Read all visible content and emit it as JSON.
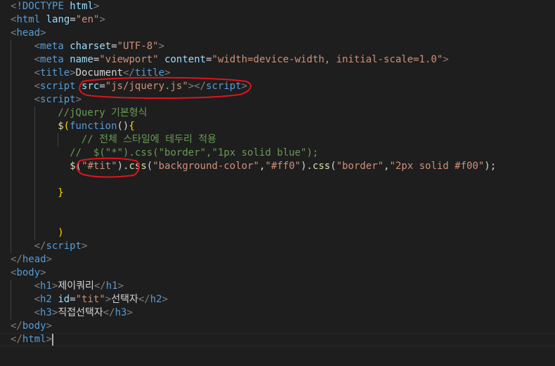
{
  "lines": [
    {
      "indent": 0,
      "tokens": [
        [
          "t-bracket",
          "<"
        ],
        [
          "t-tag",
          "!DOCTYPE "
        ],
        [
          "t-attr",
          "html"
        ],
        [
          "t-bracket",
          ">"
        ]
      ]
    },
    {
      "indent": 0,
      "tokens": [
        [
          "t-bracket",
          "<"
        ],
        [
          "t-tag",
          "html "
        ],
        [
          "t-attr",
          "lang"
        ],
        [
          "t-plain",
          "="
        ],
        [
          "t-str",
          "\"en\""
        ],
        [
          "t-bracket",
          ">"
        ]
      ]
    },
    {
      "indent": 0,
      "tokens": [
        [
          "t-bracket",
          "<"
        ],
        [
          "t-tag",
          "head"
        ],
        [
          "t-bracket",
          ">"
        ]
      ]
    },
    {
      "indent": 1,
      "tokens": [
        [
          "t-bracket",
          "<"
        ],
        [
          "t-tag",
          "meta "
        ],
        [
          "t-attr",
          "charset"
        ],
        [
          "t-plain",
          "="
        ],
        [
          "t-str",
          "\"UTF-8\""
        ],
        [
          "t-bracket",
          ">"
        ]
      ]
    },
    {
      "indent": 1,
      "tokens": [
        [
          "t-bracket",
          "<"
        ],
        [
          "t-tag",
          "meta "
        ],
        [
          "t-attr",
          "name"
        ],
        [
          "t-plain",
          "="
        ],
        [
          "t-str",
          "\"viewport\""
        ],
        [
          "t-plain",
          " "
        ],
        [
          "t-attr",
          "content"
        ],
        [
          "t-plain",
          "="
        ],
        [
          "t-str",
          "\"width=device-width, initial-scale=1.0\""
        ],
        [
          "t-bracket",
          ">"
        ]
      ]
    },
    {
      "indent": 1,
      "tokens": [
        [
          "t-bracket",
          "<"
        ],
        [
          "t-tag",
          "title"
        ],
        [
          "t-bracket",
          ">"
        ],
        [
          "t-text",
          "Document"
        ],
        [
          "t-bracket",
          "</"
        ],
        [
          "t-tag",
          "title"
        ],
        [
          "t-bracket",
          ">"
        ]
      ]
    },
    {
      "indent": 1,
      "tokens": [
        [
          "t-bracket",
          "<"
        ],
        [
          "t-tag",
          "script "
        ],
        [
          "t-attr",
          "src"
        ],
        [
          "t-plain",
          "="
        ],
        [
          "t-str",
          "\"js/jquery.js\""
        ],
        [
          "t-bracket",
          "></"
        ],
        [
          "t-tag",
          "script"
        ],
        [
          "t-bracket",
          ">"
        ]
      ]
    },
    {
      "indent": 1,
      "tokens": [
        [
          "t-bracket",
          "<"
        ],
        [
          "t-tag",
          "script"
        ],
        [
          "t-bracket",
          ">"
        ]
      ]
    },
    {
      "indent": 2,
      "tokens": [
        [
          "t-comment",
          "//jQuery 기본형식"
        ]
      ]
    },
    {
      "indent": 2,
      "tokens": [
        [
          "t-func",
          "$"
        ],
        [
          "t-brace",
          "("
        ],
        [
          "t-kw",
          "function"
        ],
        [
          "t-plain",
          "()"
        ],
        [
          "t-brace",
          "{"
        ]
      ]
    },
    {
      "indent": 3,
      "tokens": [
        [
          "t-comment",
          "// 전체 스타일에 테두리 적용"
        ]
      ]
    },
    {
      "indent": 2,
      "extra": "  ",
      "tokens": [
        [
          "t-comment",
          "//  $(\"*\").css(\"border\",\"1px solid blue\");"
        ]
      ]
    },
    {
      "indent": 2,
      "extra": "  ",
      "tokens": [
        [
          "t-func",
          "$"
        ],
        [
          "t-plain",
          "("
        ],
        [
          "t-str",
          "\"#tit\""
        ],
        [
          "t-plain",
          ")."
        ],
        [
          "t-func",
          "css"
        ],
        [
          "t-plain",
          "("
        ],
        [
          "t-str",
          "\"background-color\""
        ],
        [
          "t-plain",
          ","
        ],
        [
          "t-str",
          "\"#ff0\""
        ],
        [
          "t-plain",
          ")."
        ],
        [
          "t-func",
          "css"
        ],
        [
          "t-plain",
          "("
        ],
        [
          "t-str",
          "\"border\""
        ],
        [
          "t-plain",
          ","
        ],
        [
          "t-str",
          "\"2px solid #f00\""
        ],
        [
          "t-plain",
          ");"
        ]
      ]
    },
    {
      "indent": 2,
      "tokens": []
    },
    {
      "indent": 2,
      "tokens": [
        [
          "t-brace",
          "}"
        ]
      ]
    },
    {
      "indent": 2,
      "tokens": []
    },
    {
      "indent": 2,
      "tokens": []
    },
    {
      "indent": 2,
      "tokens": [
        [
          "t-brace",
          ")"
        ]
      ]
    },
    {
      "indent": 1,
      "tokens": [
        [
          "t-bracket",
          "</"
        ],
        [
          "t-tag",
          "script"
        ],
        [
          "t-bracket",
          ">"
        ]
      ]
    },
    {
      "indent": 0,
      "tokens": [
        [
          "t-bracket",
          "</"
        ],
        [
          "t-tag",
          "head"
        ],
        [
          "t-bracket",
          ">"
        ]
      ]
    },
    {
      "indent": 0,
      "tokens": [
        [
          "t-bracket",
          "<"
        ],
        [
          "t-tag",
          "body"
        ],
        [
          "t-bracket",
          ">"
        ]
      ]
    },
    {
      "indent": 1,
      "tokens": [
        [
          "t-bracket",
          "<"
        ],
        [
          "t-tag",
          "h1"
        ],
        [
          "t-bracket",
          ">"
        ],
        [
          "t-text",
          "제이쿼리"
        ],
        [
          "t-bracket",
          "</"
        ],
        [
          "t-tag",
          "h1"
        ],
        [
          "t-bracket",
          ">"
        ]
      ]
    },
    {
      "indent": 1,
      "tokens": [
        [
          "t-bracket",
          "<"
        ],
        [
          "t-tag",
          "h2 "
        ],
        [
          "t-attr",
          "id"
        ],
        [
          "t-plain",
          "="
        ],
        [
          "t-str",
          "\"tit\""
        ],
        [
          "t-bracket",
          ">"
        ],
        [
          "t-text",
          "선택자"
        ],
        [
          "t-bracket",
          "</"
        ],
        [
          "t-tag",
          "h2"
        ],
        [
          "t-bracket",
          ">"
        ]
      ]
    },
    {
      "indent": 1,
      "tokens": [
        [
          "t-bracket",
          "<"
        ],
        [
          "t-tag",
          "h3"
        ],
        [
          "t-bracket",
          ">"
        ],
        [
          "t-text",
          "직접선택자"
        ],
        [
          "t-bracket",
          "</"
        ],
        [
          "t-tag",
          "h3"
        ],
        [
          "t-bracket",
          ">"
        ]
      ]
    },
    {
      "indent": 0,
      "tokens": [
        [
          "t-bracket",
          "</"
        ],
        [
          "t-tag",
          "body"
        ],
        [
          "t-bracket",
          ">"
        ]
      ]
    },
    {
      "indent": 0,
      "tokens": [
        [
          "t-bracket",
          "</"
        ],
        [
          "t-tag",
          "html"
        ],
        [
          "t-bracket",
          ">"
        ]
      ]
    }
  ],
  "annotation_color": "#e0141e",
  "cursor_line": 25
}
